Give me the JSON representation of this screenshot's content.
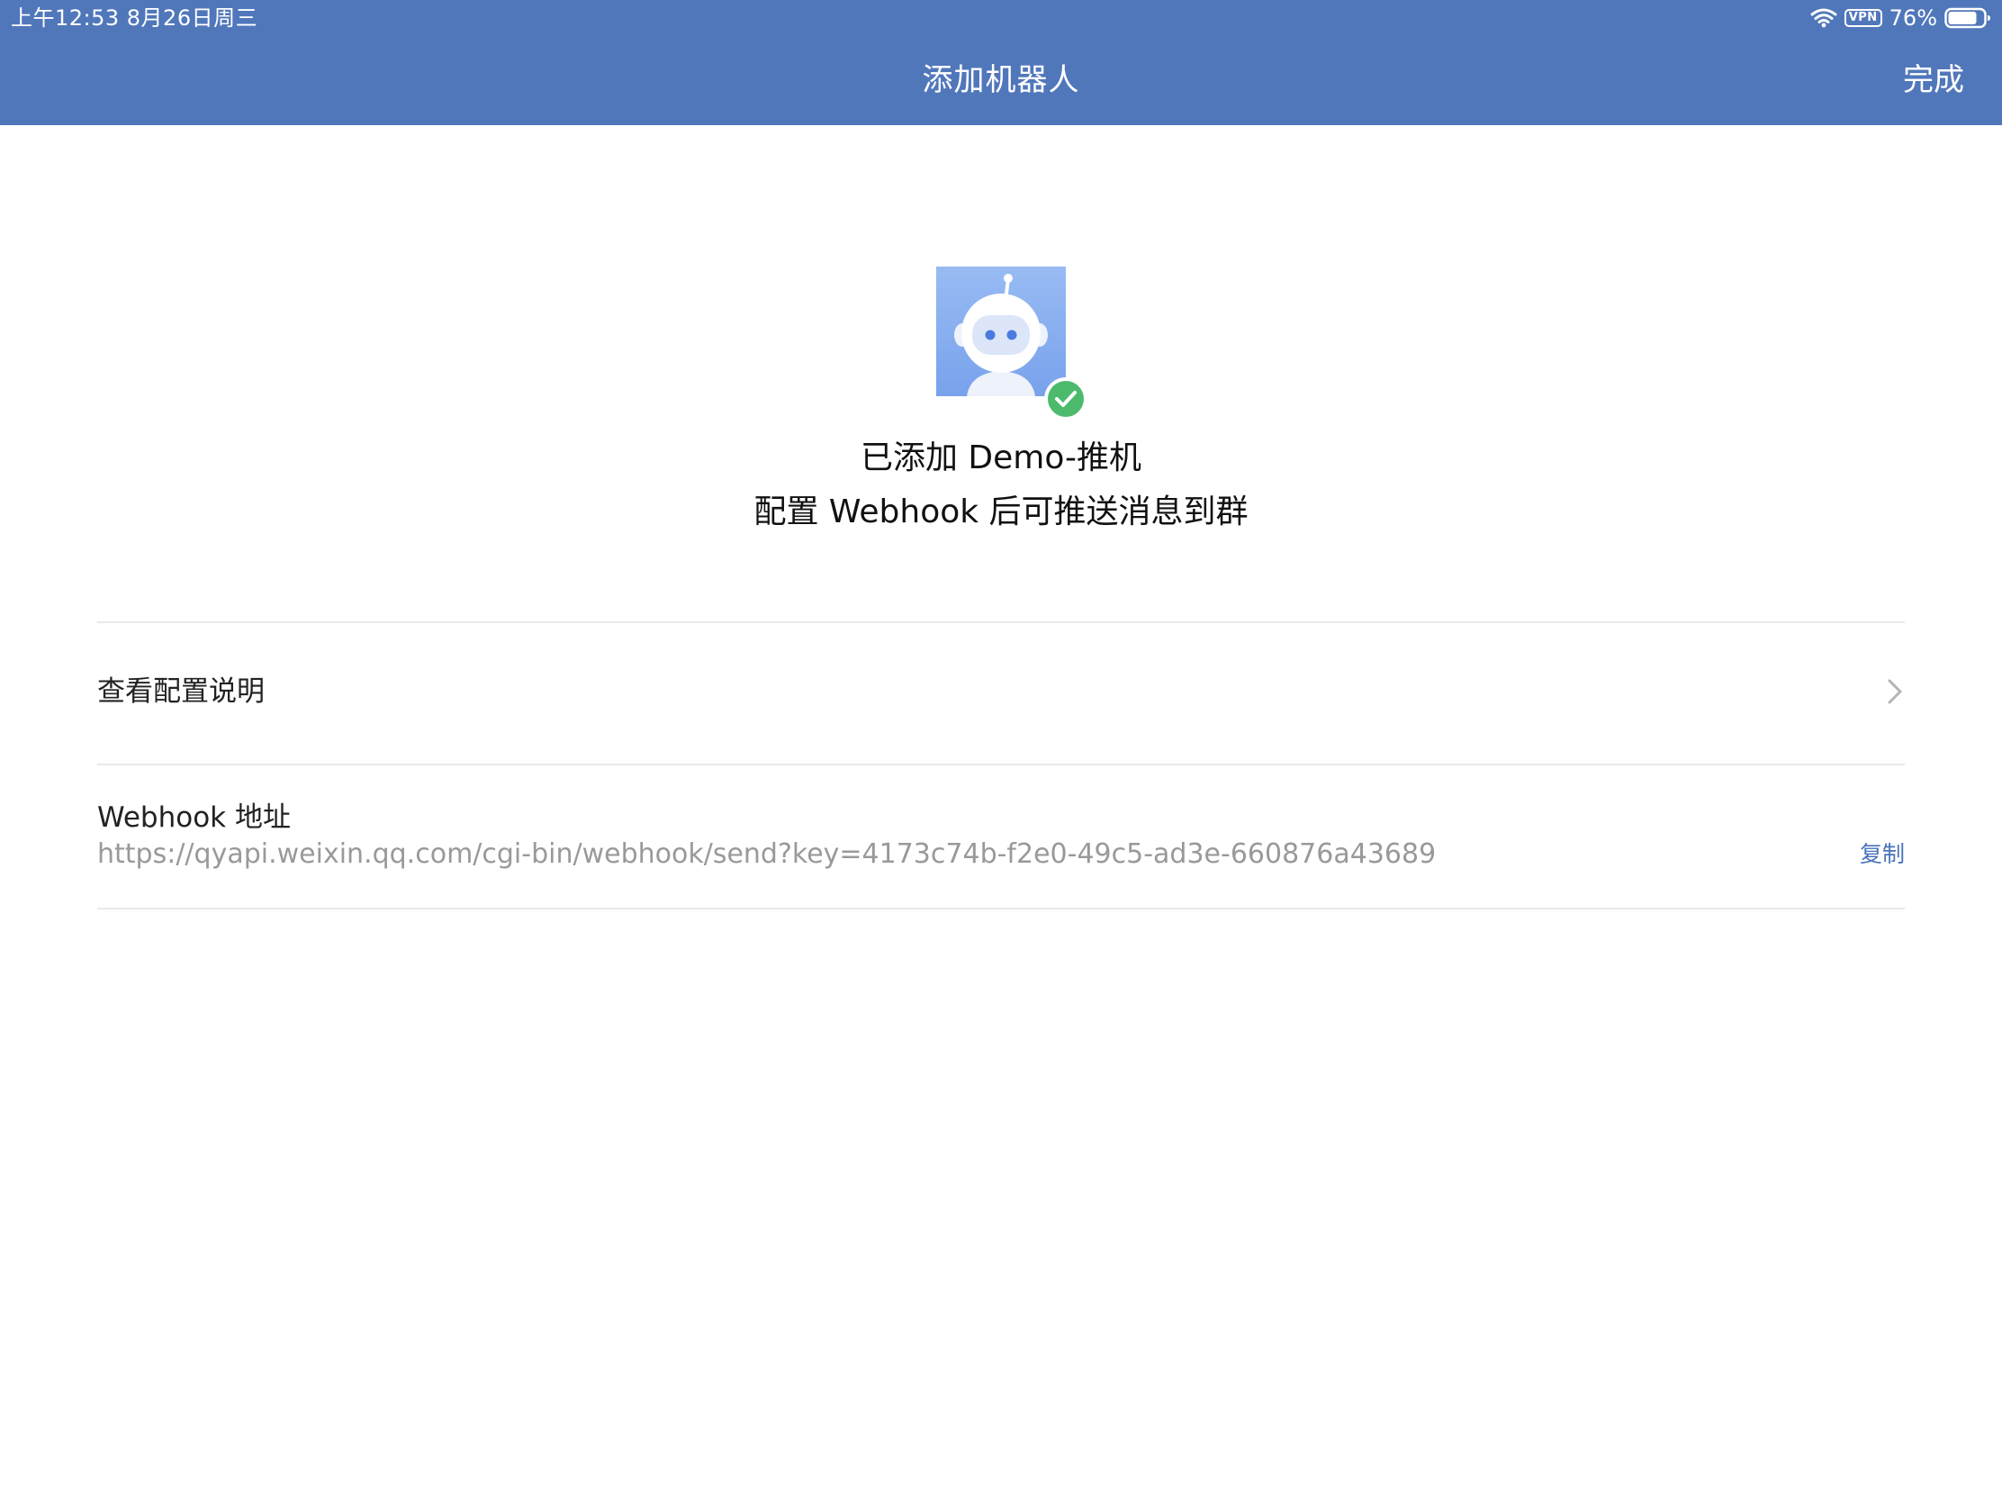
{
  "status_bar": {
    "time_date": "上午12:53   8月26日周三",
    "vpn": "VPN",
    "battery": "76%"
  },
  "nav": {
    "title": "添加机器人",
    "done_label": "完成"
  },
  "bot": {
    "added_text": "已添加 Demo-推机",
    "subtitle": "配置 Webhook 后可推送消息到群"
  },
  "rows": {
    "config_label": "查看配置说明",
    "webhook_label": "Webhook 地址",
    "webhook_url": "https://qyapi.weixin.qq.com/cgi-bin/webhook/send?key=4173c74b-f2e0-49c5-ad3e-660876a43689",
    "copy_label": "复制"
  },
  "colors": {
    "header": "#5177bb",
    "accent": "#4a73b9",
    "success": "#4cba6c"
  }
}
